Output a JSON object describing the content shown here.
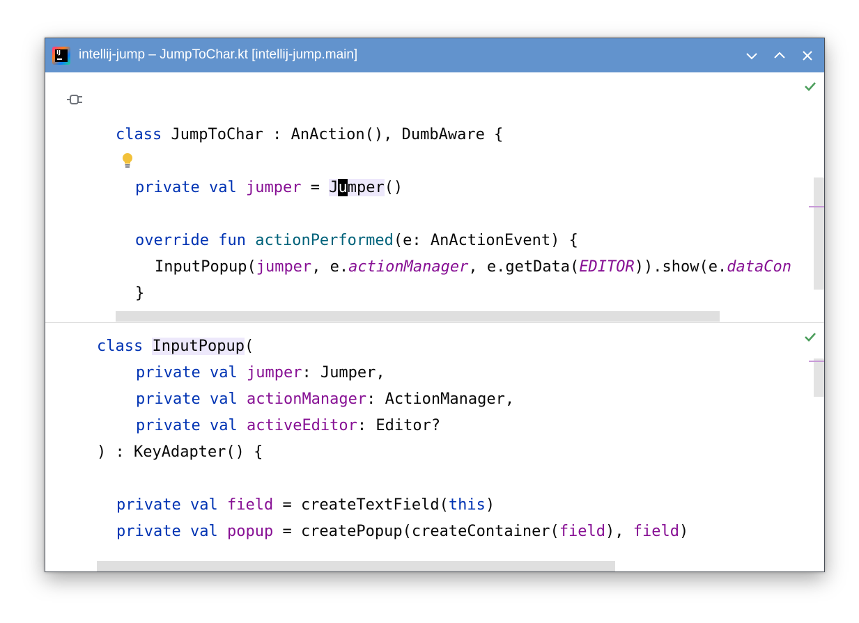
{
  "window": {
    "title": "intellij-jump – JumpToChar.kt [intellij-jump.main]",
    "logo_text": "IJ",
    "buttons": [
      "chevron-down",
      "chevron-up",
      "close"
    ]
  },
  "colors": {
    "titlebar": "#6293cd",
    "keyword": "#0033b3",
    "property": "#871094",
    "function": "#00627a",
    "check": "#4c9e5c"
  },
  "pane1": {
    "l1": {
      "kw": "class",
      "rest": " JumpToChar : AnAction(), DumbAware {"
    },
    "l2": {
      "kw1": "private",
      "kw2": "val",
      "prop": "jumper",
      "eq": " = ",
      "pre": "J",
      "caret": "u",
      "post": "mper",
      "tail": "()"
    },
    "l3": {
      "kw1": "override",
      "kw2": "fun",
      "fn": "actionPerformed",
      "rest": "(e: AnActionEvent) {"
    },
    "l4": {
      "a": "InputPopup(",
      "p1": "jumper",
      "b": ", e.",
      "p2": "actionManager",
      "c": ", e.getData(",
      "p3": "EDITOR",
      "d": ")).show(e.",
      "p4": "dataCon"
    },
    "l5": "}",
    "l6": "}"
  },
  "pane2": {
    "l1": {
      "kw": "class",
      "name": "InputPopup",
      "rest": "("
    },
    "l2": {
      "kw1": "private",
      "kw2": "val",
      "prop": "jumper",
      "rest": ": Jumper,"
    },
    "l3": {
      "kw1": "private",
      "kw2": "val",
      "prop": "actionManager",
      "rest": ": ActionManager,"
    },
    "l4": {
      "kw1": "private",
      "kw2": "val",
      "prop": "activeEditor",
      "rest": ": Editor?"
    },
    "l5": ") : KeyAdapter() {",
    "l6": {
      "kw1": "private",
      "kw2": "val",
      "prop": "field",
      "a": " = createTextField(",
      "kw3": "this",
      "b": ")"
    },
    "l7": {
      "kw1": "private",
      "kw2": "val",
      "prop": "popup",
      "a": " = createPopup(createContainer(",
      "p1": "field",
      "b": "), ",
      "p2": "field",
      "c": ")"
    }
  }
}
